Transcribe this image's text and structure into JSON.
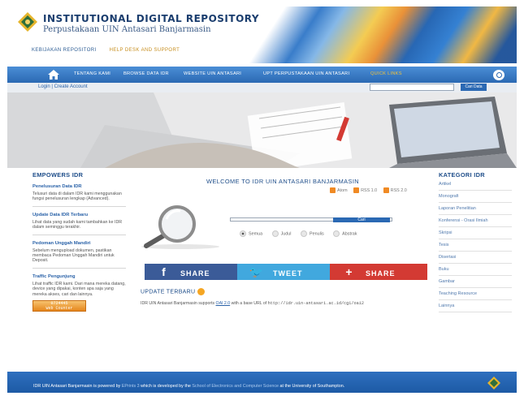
{
  "header": {
    "title": "INSTITUTIONAL DIGITAL REPOSITORY",
    "subtitle": "Perpustakaan UIN Antasari Banjarmasin",
    "toplinks": [
      "KEBIJAKAN REPOSITORI",
      "HELP DESK AND SUPPORT"
    ]
  },
  "nav": {
    "items": [
      "TENTANG KAMI",
      "BROWSE DATA IDR",
      "WEBSITE UIN ANTASARI",
      "UPT PERPUSTAKAAN UIN ANTASARI",
      "QUICK LINKS"
    ],
    "home_icon": "home-icon",
    "search_icon": "search-icon"
  },
  "login": {
    "login_label": "Login",
    "separator": "|",
    "create_label": "Create Account",
    "search_button": "Cari Data"
  },
  "left": {
    "heading": "EMPOWERS IDR",
    "blocks": [
      {
        "title": "Penelusuran Data IDR",
        "text": "Telusuri data di dalam IDR kami menggunakan fungsi penelusuran lengkap (Advanced)."
      },
      {
        "title": "Update Data IDR Terbaru",
        "text": "Lihat data yang sudah kami tambahkan ke IDR dalam seminggu terakhir."
      },
      {
        "title": "Pedoman Unggah Mandiri",
        "text": "Sebelum mengupload dokumen, pastikan membaca Pedoman Unggah Mandiri untuk Deposit."
      },
      {
        "title": "Traffic Pengunjung",
        "text": "Lihat traffic IDR kami. Dari mana mereka datang, device yang dipakai, konten apa saja yang mereka akses, cari dan lainnya."
      }
    ],
    "counter_value": "0724445",
    "counter_caption": "Web Counter"
  },
  "main": {
    "welcome": "WELCOME TO IDR UIN ANTASARI BANJARMASIN",
    "feeds": [
      "Atom",
      "RSS 1.0",
      "RSS 2.0"
    ],
    "search_button": "Cari",
    "radios": [
      "Semua",
      "Judul",
      "Penulis",
      "Abstrak"
    ],
    "share": [
      {
        "label": "SHARE",
        "glyph": "f",
        "color": "#3b5b98"
      },
      {
        "label": "TWEET",
        "glyph": "🐦",
        "color": "#41a8de"
      },
      {
        "label": "SHARE",
        "glyph": "+",
        "color": "#d33a33"
      }
    ],
    "update_title": "UPDATE TERBARU",
    "update_text_1": "IDR UIN Antasari Banjarmasin supports ",
    "update_link": "OAI 2.0",
    "update_text_2": " with a base URL of ",
    "update_url": "http://idr.uin-antasari.ac.id/cgi/oai2"
  },
  "right": {
    "heading": "KATEGORI IDR",
    "items": [
      "Artikel",
      "Monografi",
      "Laporan Penelitian",
      "Konferensi - Orasi Ilmiah",
      "Skripsi",
      "Tesis",
      "Disertasi",
      "Buku",
      "Gambar",
      "Teaching Resource",
      "Lainnya"
    ]
  },
  "footer": {
    "text_1": "IDR UIN Antasari Banjarmasin is powered by ",
    "text_2": "EPrints 3",
    "text_3": " which is developed by the ",
    "text_4": "School of Electronics and Computer Science",
    "text_5": " at the University of Southampton."
  }
}
